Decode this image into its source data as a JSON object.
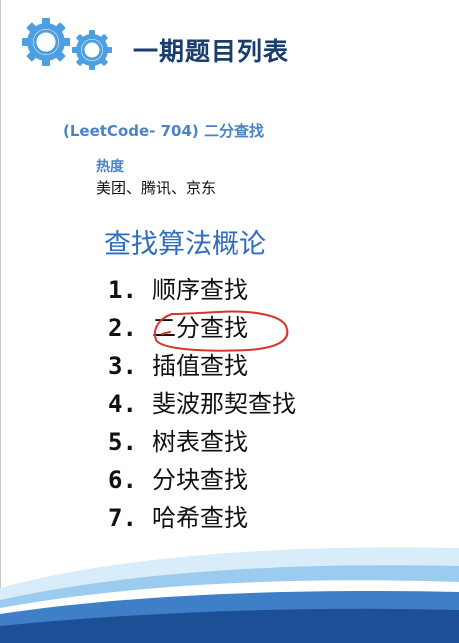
{
  "header": {
    "title": "一期题目列表"
  },
  "problem": {
    "text": "(LeetCode- 704) 二分查找"
  },
  "heat": {
    "label": "热度",
    "companies": "美团、腾讯、京东"
  },
  "section": {
    "title": "查找算法概论"
  },
  "items": [
    {
      "num": "1.",
      "label": "顺序查找"
    },
    {
      "num": "2.",
      "label": "二分查找"
    },
    {
      "num": "3.",
      "label": "插值查找"
    },
    {
      "num": "4.",
      "label": "斐波那契查找"
    },
    {
      "num": "5.",
      "label": "树表查找"
    },
    {
      "num": "6.",
      "label": "分块查找"
    },
    {
      "num": "7.",
      "label": "哈希查找"
    }
  ],
  "colors": {
    "title": "#173e6f",
    "accent": "#4a84c4",
    "section": "#2f6dbe",
    "annotation": "#d8332c",
    "gear": "#4e9fe0"
  },
  "icons": {
    "header": "gears-icon",
    "annotation": "hand-drawn-circle-annotation"
  }
}
